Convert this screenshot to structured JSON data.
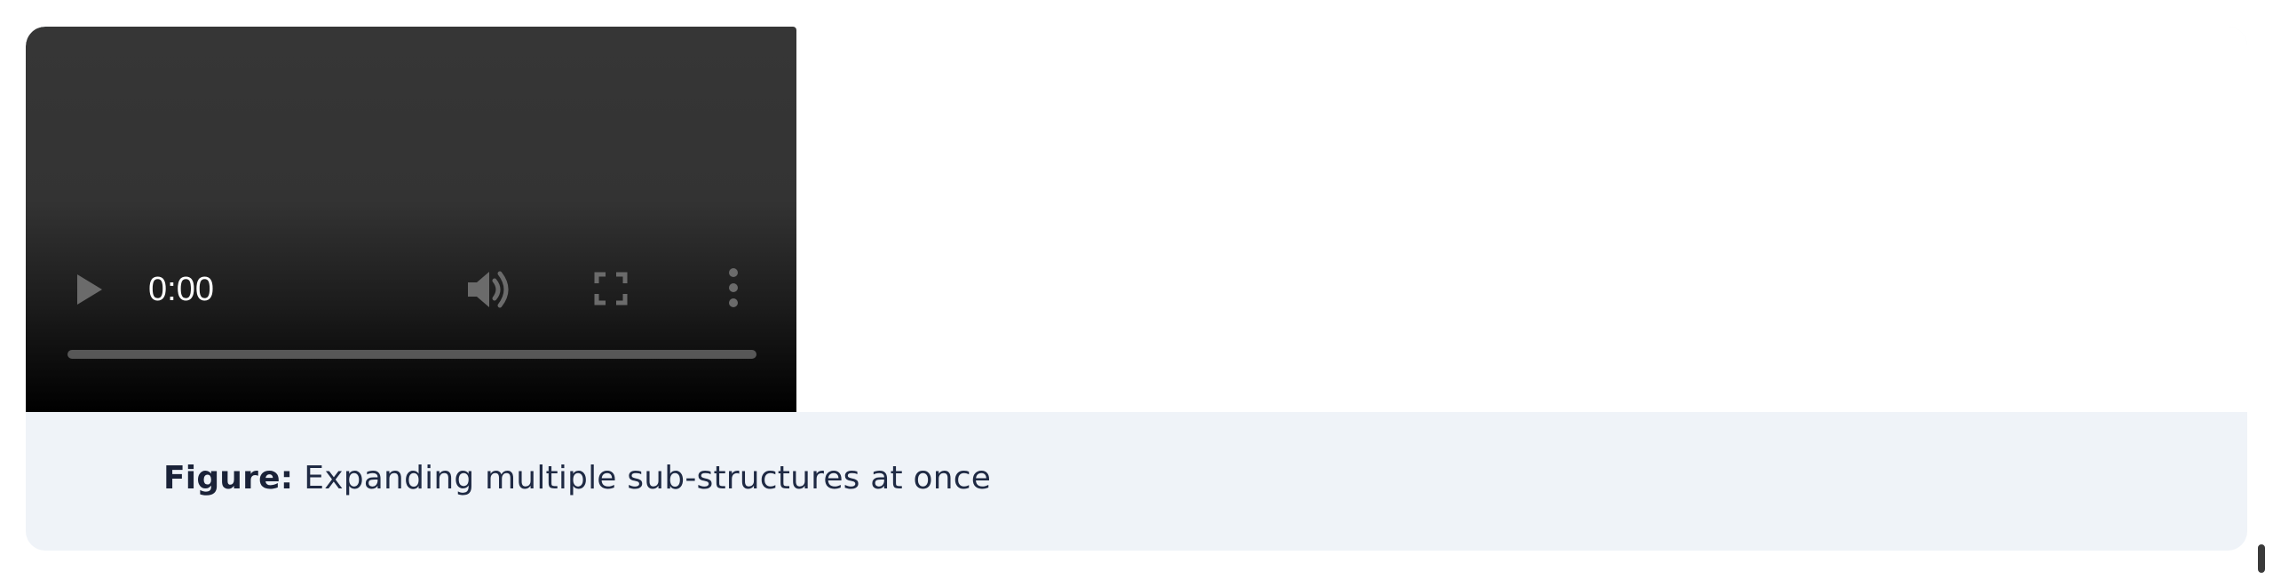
{
  "video": {
    "time": "0:00",
    "progress_fraction": 0,
    "icons": {
      "play": "play-icon",
      "volume": "volume-icon",
      "fullscreen": "fullscreen-icon",
      "more": "more-vertical-icon"
    }
  },
  "caption": {
    "label": "Figure:",
    "text": "Expanding multiple sub-structures at once"
  },
  "colors": {
    "caption_background": "#eff3f8",
    "caption_text": "#1f2a44",
    "video_background": "#333333",
    "control_icons": "#6b6b6b",
    "progress_track": "#575757"
  }
}
